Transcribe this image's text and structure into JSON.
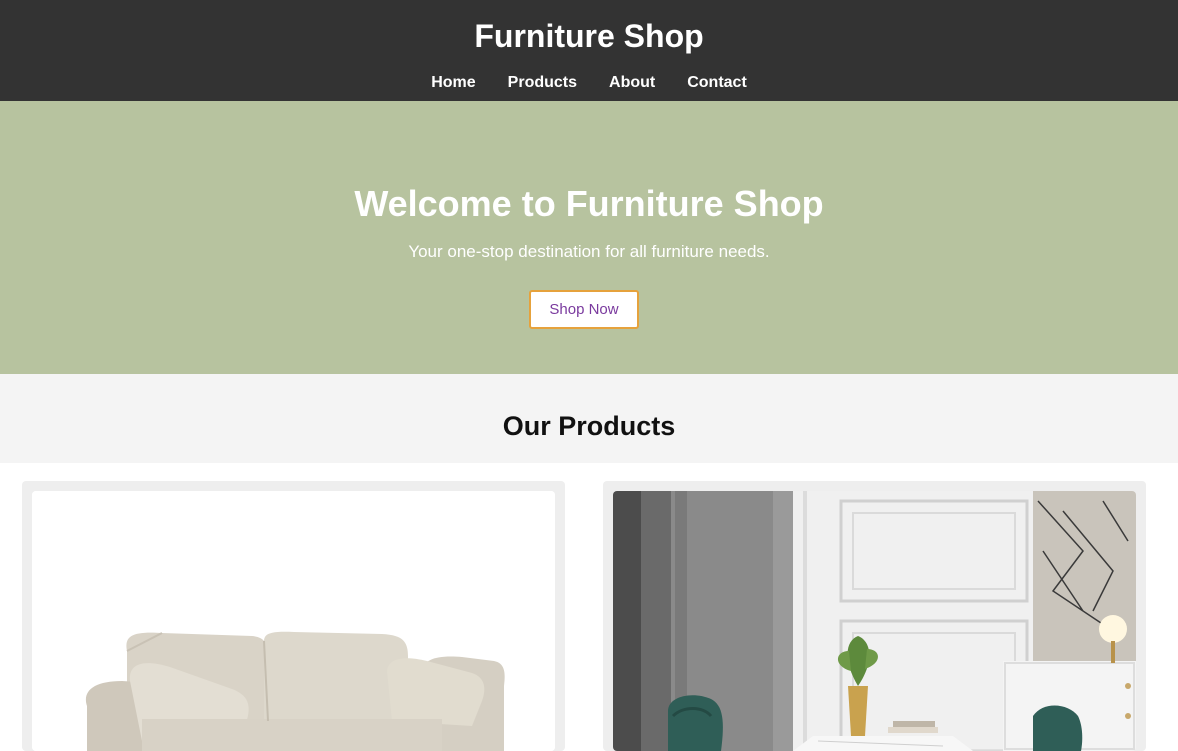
{
  "header": {
    "title": "Furniture Shop",
    "nav": [
      "Home",
      "Products",
      "About",
      "Contact"
    ]
  },
  "hero": {
    "title": "Welcome to Furniture Shop",
    "subtitle": "Your one-stop destination for all furniture needs.",
    "button_label": "Shop Now"
  },
  "products": {
    "section_title": "Our Products",
    "items": [
      {
        "image": "sofa-image"
      },
      {
        "image": "dining-room-image"
      }
    ]
  },
  "colors": {
    "header_bg": "#333333",
    "hero_bg": "#b7c39f",
    "section_bg": "#f4f4f4",
    "button_text": "#7a3a9e",
    "button_border": "#e6a23c"
  }
}
